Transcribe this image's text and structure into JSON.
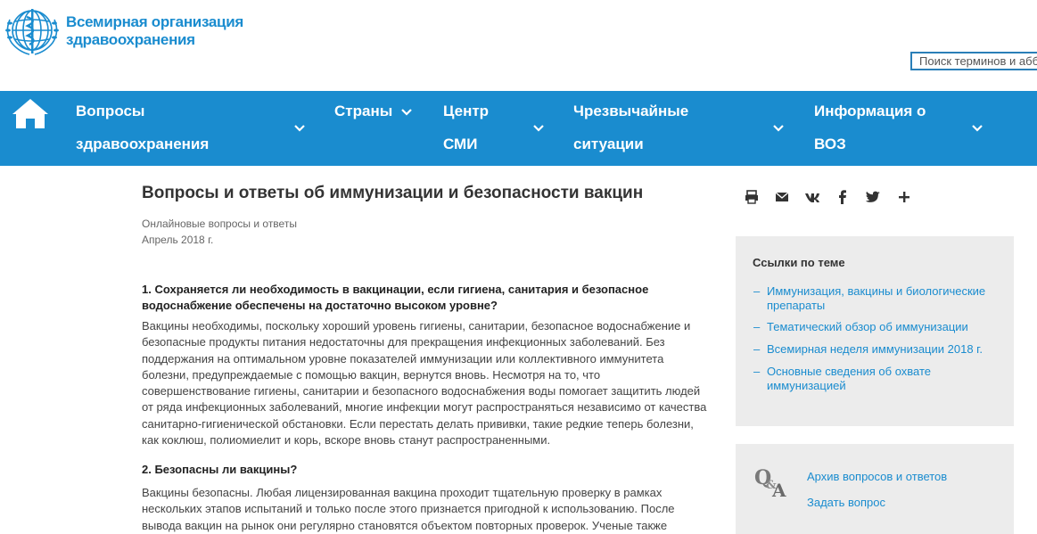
{
  "header": {
    "logo_line1": "Всемирная организация",
    "logo_line2": "здравоохранения",
    "search_placeholder": "Поиск терминов и аббревиатур"
  },
  "nav": {
    "items": [
      {
        "line1": "Вопросы",
        "line2": "здравоохранения"
      },
      {
        "line1": "Страны",
        "line2": ""
      },
      {
        "line1": "Центр",
        "line2": "СМИ"
      },
      {
        "line1": "Чрезвычайные",
        "line2": "ситуации"
      },
      {
        "line1": "Информация о",
        "line2": "ВОЗ"
      }
    ]
  },
  "article": {
    "title": "Вопросы и ответы об иммунизации и безопасности вакцин",
    "meta_type": "Онлайновые вопросы и ответы",
    "meta_date": "Апрель 2018 г.",
    "q1_line1": "1. Сохраняется ли необходимость в вакцинации, если гигиена, санитария и безопасное",
    "q1_line2": "водоснабжение обеспечены на достаточно высоком уровне?",
    "a1": [
      "Вакцины необходимы, поскольку хороший уровень гигиены, санитарии, безопасное водоснабжение и",
      "безопасные продукты питания недостаточны для прекращения инфекционных заболеваний. Без",
      "поддержания на оптимальном уровне показателей иммунизации или коллективного иммунитета",
      "болезни, предупреждаемые с помощью вакцин, вернутся вновь. Несмотря на то, что",
      "совершенствование гигиены, санитарии и безопасного водоснабжения воды помогает защитить людей",
      "от ряда инфекционных заболеваний, многие инфекции могут распространяться независимо от качества",
      "санитарно-гигиенической обстановки. Если перестать делать прививки, такие редкие теперь болезни,",
      "как коклюш, полиомиелит и корь, вскоре вновь станут распространенными."
    ],
    "q2": "2. Безопасны ли вакцины?",
    "a2": [
      "Вакцины безопасны. Любая лицензированная вакцина проходит тщательную проверку в рамках",
      "нескольких этапов испытаний и только после этого признается пригодной к использованию. После",
      "вывода вакцин на рынок они регулярно становятся объектом повторных проверок. Ученые также"
    ]
  },
  "share": {
    "icons": [
      "print-icon",
      "email-icon",
      "vk-icon",
      "facebook-icon",
      "twitter-icon",
      "plus-icon"
    ]
  },
  "sidebar": {
    "related_title": "Ссылки по теме",
    "links": [
      {
        "line1": "Иммунизация, вакцины и биологические",
        "line2": "препараты"
      },
      {
        "line1": "Тематический обзор об иммунизации",
        "line2": ""
      },
      {
        "line1": "Всемирная неделя иммунизации 2018 г.",
        "line2": ""
      },
      {
        "line1": "Основные сведения об охвате",
        "line2": "иммунизацией"
      }
    ],
    "qa_archive": "Архив вопросов и ответов",
    "qa_ask": "Задать вопрос"
  },
  "colors": {
    "brand": "#1a8ccf",
    "sidebar_bg": "#ececec"
  }
}
